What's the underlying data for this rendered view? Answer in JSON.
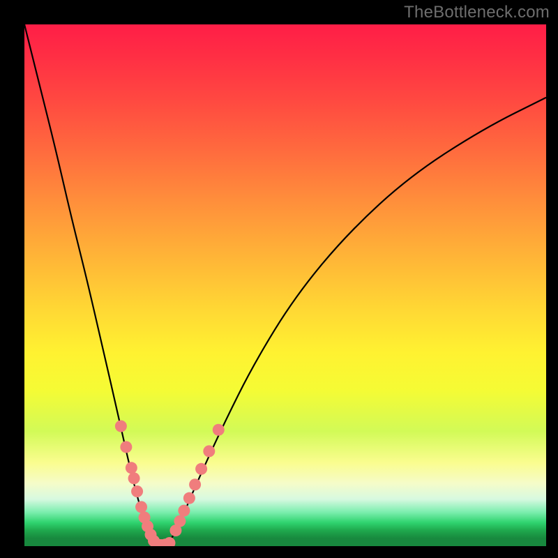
{
  "watermark": "TheBottleneck.com",
  "colors": {
    "frame": "#000000",
    "curve": "#000000",
    "curve_highlight": "#f07d7d",
    "watermark": "#6e6e6e",
    "gradient_top": "#ff1e47",
    "gradient_mid": "#fff231",
    "gradient_bottom": "#18893e"
  },
  "chart_data": {
    "type": "line",
    "title": "",
    "xlabel": "",
    "ylabel": "",
    "xlim": [
      0,
      100
    ],
    "ylim": [
      0,
      100
    ],
    "grid": false,
    "legend": false,
    "annotations": [
      "TheBottleneck.com"
    ],
    "series": [
      {
        "name": "bottleneck-curve",
        "x": [
          0,
          3,
          6,
          9,
          12,
          15,
          18,
          20,
          22,
          24,
          25.5,
          27,
          28,
          30,
          33,
          38,
          44,
          52,
          62,
          74,
          88,
          100
        ],
        "y": [
          100,
          88,
          76,
          63,
          51,
          38,
          25,
          16,
          8,
          2,
          0,
          0,
          1,
          5,
          12,
          23,
          35,
          48,
          60,
          71,
          80,
          86
        ]
      }
    ],
    "highlighted_segments": [
      {
        "name": "left-dots",
        "x": [
          18.5,
          19.5,
          20.5,
          21.0,
          21.6,
          22.4,
          23.0,
          23.6,
          24.2,
          24.8
        ],
        "y": [
          23.0,
          19.0,
          15.0,
          13.0,
          10.5,
          7.5,
          5.5,
          3.8,
          2.2,
          1.0
        ]
      },
      {
        "name": "valley-dots",
        "x": [
          25.5,
          26.2,
          27.0,
          27.8
        ],
        "y": [
          0.3,
          0.2,
          0.3,
          0.6
        ]
      },
      {
        "name": "right-dots",
        "x": [
          29.0,
          29.8,
          30.6,
          31.6,
          32.7,
          33.9,
          35.4,
          37.2
        ],
        "y": [
          3.0,
          4.8,
          6.8,
          9.2,
          11.8,
          14.8,
          18.2,
          22.3
        ]
      }
    ]
  }
}
